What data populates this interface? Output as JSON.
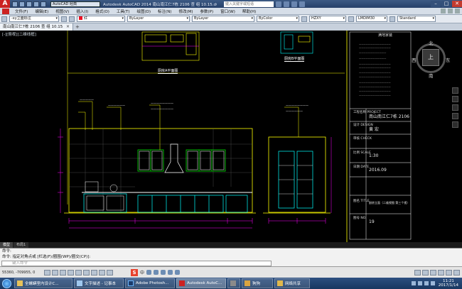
{
  "titlebar": {
    "logo": "A",
    "workspace": "AutoCAD 经典",
    "title": "Autodesk AutoCAD 2014   南山南江仁7栋 2106 查 组   10.15.dwg",
    "search_placeholder": "键入关键字或短语",
    "min": "–",
    "max": "□",
    "close": "✕"
  },
  "menu": {
    "items": [
      "文件(F)",
      "编辑(E)",
      "视图(V)",
      "插入(I)",
      "格式(O)",
      "工具(T)",
      "绘图(D)",
      "标注(N)",
      "修改(M)",
      "参数(P)",
      "窗口(W)",
      "帮助(H)"
    ]
  },
  "toolbar": {
    "style_combo": "-xy立面标注",
    "color_combo": "红",
    "linetype_combo": "ByLayer",
    "lineweight_combo": "ByLayer",
    "plotstyle_combo": "ByColor",
    "textstyle_combo": "HZXY",
    "dimstyle_combo": "LMDIM30",
    "tablestyle_combo": "Standard"
  },
  "tabs": {
    "doc_tab": "南山南江仁7栋 2106 查 组 10.15",
    "close": "×",
    "add": "+"
  },
  "canvas": {
    "view_label": "[-][俯视][二维线框]",
    "viewcube": {
      "north": "北",
      "south": "南",
      "west": "西",
      "east": "东",
      "face": "上"
    },
    "plan_labels": {
      "a": "厨房A平面图",
      "b": "厨房B平面图"
    },
    "titleblock": {
      "firm": "满地家装",
      "rows": [
        {
          "label": "工程名称\nPROJECT",
          "value": "南山南江仁7栋 2106"
        },
        {
          "label": "设计\nDESIGN",
          "value": "黄 宏"
        },
        {
          "label": "审核\nCHECK",
          "value": ""
        },
        {
          "label": "比例\nSCALE",
          "value": "1:30"
        },
        {
          "label": "日期\nDATE",
          "value": "2016.09"
        },
        {
          "label": "图名\nTITLE",
          "value": "厨房立面（二维视图 第三个视）"
        },
        {
          "label": "图号\nNO.",
          "value": "19"
        }
      ]
    }
  },
  "layout_tabs": [
    "模型",
    "布局1"
  ],
  "command": {
    "line1": "命令:",
    "line2": "命令: 指定对角点或 [栏选(F)/圈围(WP)/圈交(CP)]:",
    "input_placeholder": "键入命令"
  },
  "status": {
    "coords": "55360, -709955, 0",
    "ime_logo": "S",
    "ime_lang": "中"
  },
  "taskbar": {
    "tasks": [
      "全螺蟒室内设计C...",
      "文字描述 - 记事本",
      "Adobe Photosh...",
      "Autodesk AutoC...",
      "",
      "狗狗",
      "网络共享"
    ],
    "time": "11:21",
    "date": "2017/1/14"
  },
  "colors": {
    "accent_red": "#c43b2f",
    "cad_yellow": "#ffff00",
    "cad_cyan": "#00ffff",
    "cad_green": "#00ff00",
    "cad_magenta": "#ff00ff"
  }
}
